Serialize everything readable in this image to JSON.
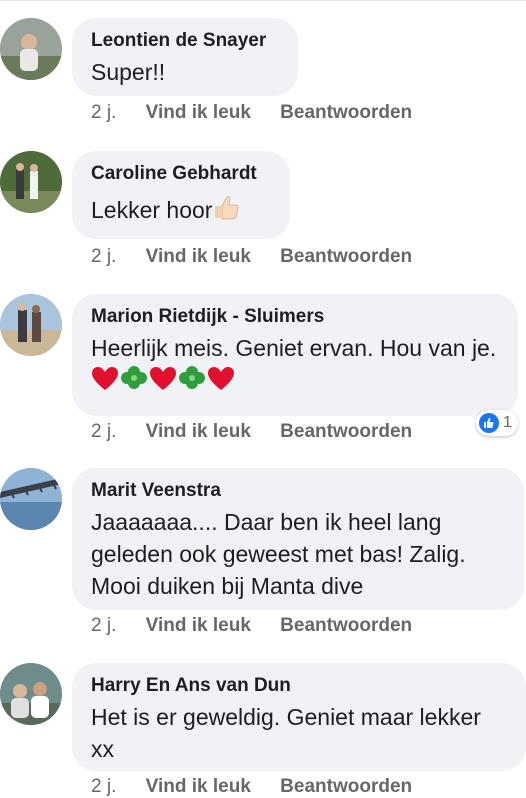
{
  "comments": [
    {
      "author": "Leontien de Snayer",
      "text": "Super!!",
      "time": "2 j.",
      "like": "Vind ik leuk",
      "reply": "Beantwoorden"
    },
    {
      "author": "Caroline Gebhardt",
      "text": "Lekker hoor",
      "time": "2 j.",
      "like": "Vind ik leuk",
      "reply": "Beantwoorden",
      "emoji": "thumbs-up"
    },
    {
      "author": "Marion Rietdijk - Sluimers",
      "text": "Heerlijk meis. Geniet ervan. Hou van je.",
      "time": "2 j.",
      "like": "Vind ik leuk",
      "reply": "Beantwoorden",
      "reaction_count": "1",
      "emoji_sequence": [
        "heart",
        "clover",
        "heart",
        "clover",
        "heart"
      ]
    },
    {
      "author": "Marit Veenstra",
      "text": "Jaaaaaaa.... Daar ben ik heel lang geleden ook geweest met bas! Zalig. Mooi duiken bij Manta dive",
      "time": "2 j.",
      "like": "Vind ik leuk",
      "reply": "Beantwoorden"
    },
    {
      "author": "Harry En Ans van Dun",
      "text": "Het is er geweldig. Geniet maar lekker xx",
      "time": "2 j.",
      "like": "Vind ik leuk",
      "reply": "Beantwoorden"
    }
  ],
  "colors": {
    "bubble": "#f0f2f5",
    "meta": "#65676b",
    "like_blue": "#1877f2",
    "heart": "#e0102e",
    "clover": "#2e9e3a"
  }
}
